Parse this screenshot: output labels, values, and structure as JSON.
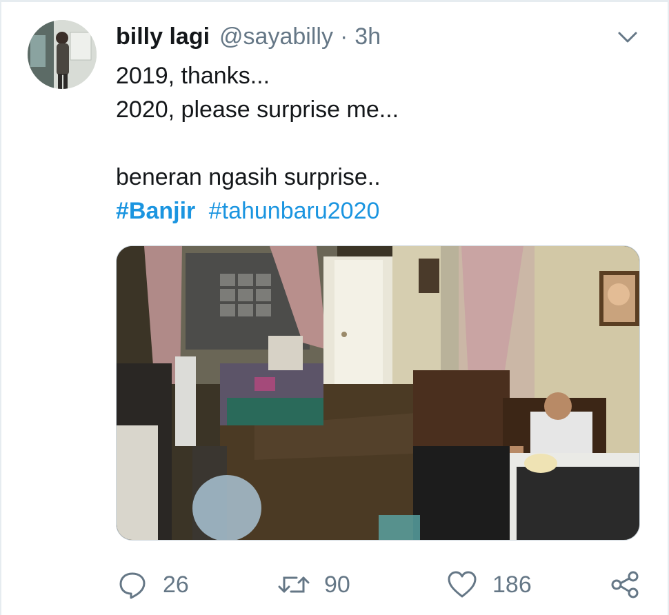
{
  "tweet": {
    "author_name": "billy lagi",
    "author_handle": "@sayabilly",
    "separator": "·",
    "time": "3h",
    "lines": [
      "2019, thanks...",
      "2020, please surprise me...",
      "",
      "beneran ngasih surprise.."
    ],
    "hashtags": [
      "#Banjir",
      "#tahunbaru2020"
    ]
  },
  "actions": {
    "reply_count": "26",
    "retweet_count": "90",
    "like_count": "186"
  },
  "colors": {
    "link": "#1b95e0",
    "muted": "#657786",
    "text": "#14171a",
    "border": "#e6ecf0"
  },
  "icons": {
    "menu": "chevron-down-icon",
    "reply": "speech-bubble-icon",
    "retweet": "retweet-arrows-icon",
    "like": "heart-icon",
    "share": "share-nodes-icon"
  }
}
